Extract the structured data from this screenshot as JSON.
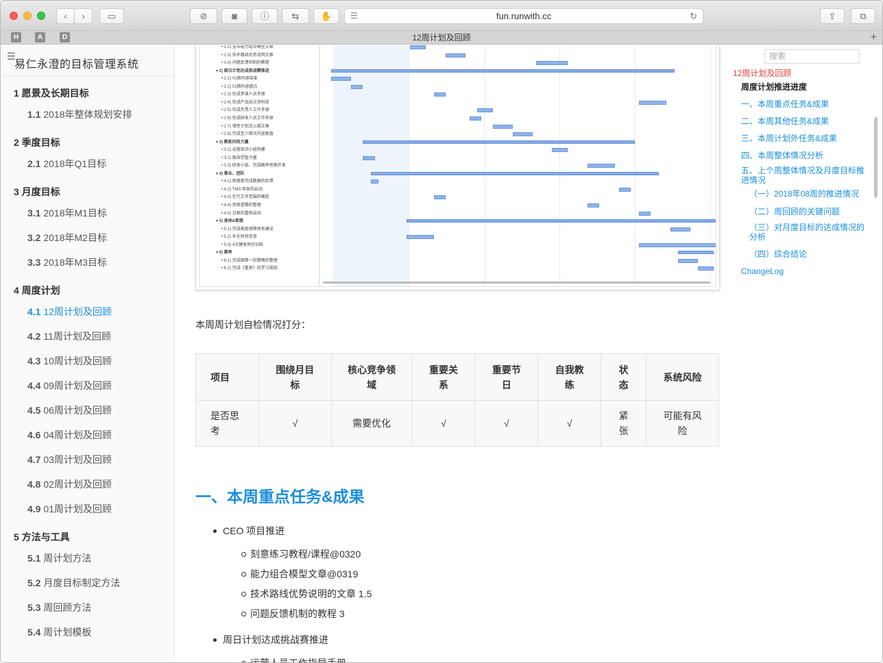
{
  "browser": {
    "url": "fun.runwith.cc",
    "tab_title": "12周计划及回顾",
    "favicons": [
      "H",
      "A",
      "D"
    ]
  },
  "sidebar": {
    "site_title": "易仁永澄的目标管理系统",
    "sections": [
      {
        "num": "1",
        "label": "愿景及长期目标",
        "items": [
          {
            "num": "1.1",
            "label": "2018年整体规划安排"
          }
        ]
      },
      {
        "num": "2",
        "label": "季度目标",
        "items": [
          {
            "num": "2.1",
            "label": "2018年Q1目标"
          }
        ]
      },
      {
        "num": "3",
        "label": "月度目标",
        "items": [
          {
            "num": "3.1",
            "label": "2018年M1目标"
          },
          {
            "num": "3.2",
            "label": "2018年M2目标"
          },
          {
            "num": "3.3",
            "label": "2018年M3目标"
          }
        ]
      },
      {
        "num": "4",
        "label": "周度计划",
        "items": [
          {
            "num": "4.1",
            "label": "12周计划及回顾"
          },
          {
            "num": "4.2",
            "label": "11周计划及回顾"
          },
          {
            "num": "4.3",
            "label": "10周计划及回顾"
          },
          {
            "num": "4.4",
            "label": "09周计划及回顾"
          },
          {
            "num": "4.5",
            "label": "06周计划及回顾"
          },
          {
            "num": "4.6",
            "label": "04周计划及回顾"
          },
          {
            "num": "4.7",
            "label": "03周计划及回顾"
          },
          {
            "num": "4.8",
            "label": "02周计划及回顾"
          },
          {
            "num": "4.9",
            "label": "01周计划及回顾"
          }
        ]
      },
      {
        "num": "5",
        "label": "方法与工具",
        "items": [
          {
            "num": "5.1",
            "label": "周计划方法"
          },
          {
            "num": "5.2",
            "label": "月度目标制定方法"
          },
          {
            "num": "5.3",
            "label": "周回顾方法"
          },
          {
            "num": "5.4",
            "label": "周计划模板"
          }
        ]
      }
    ]
  },
  "gantt": {
    "rows": [
      "• 1.2) 宣布能力组合模型文章",
      "• 1.3) 技术路线优势说明文章",
      "• 1.4) 问题反馈机制的教程",
      "▾ 2) 周日计划达成挑战赛推进",
      "• 2.1) 01期内容结束",
      "• 2.2) 01期内容盘点",
      "• 2.3) 形成参谋人员手册",
      "• 2.4) 形成产品站点资料库",
      "• 2.5) 形成负责人工作手册",
      "• 2.6) 形成研发人员工作手册",
      "• 2.7) 律性计划怎么做文章",
      "• 2.8) 完成至少两次内容复盘",
      "▾ 3) 教练问效力量",
      "• 3.1) 运营知识小组构建",
      "• 3.2) 做自您智力量",
      "• 3.3) 研发小组、完成概率思维开发",
      "▾ 4) 事业、团队",
      "• 4.1) 梳理甚完成数据的反馈",
      "• 4.2) TMS 项目的启动",
      "• 4.3) 在行工作范围的确定",
      "• 4.4) 思维逻辑的整理",
      "• 4.5) 日更的重新启动",
      "▾ 5) 身体&家庭",
      "• 5.1) 完成家庭保障体系建设",
      "• 5.2) 补全财务信息",
      "• 5.3) 4次健身房的训练",
      "▾ 6) 素养",
      "• 6.1) 完成微第一的策略的整理",
      "• 6.2) 完成《重来》的学习规划"
    ],
    "bars": [
      [
        0.23,
        0.04
      ],
      [
        0.32,
        0.05
      ],
      [
        0.55,
        0.08
      ],
      [
        0.03,
        0.87
      ],
      [
        0.03,
        0.05
      ],
      [
        0.08,
        0.03
      ],
      [
        0.29,
        0.03
      ],
      [
        0.81,
        0.07
      ],
      [
        0.4,
        0.04
      ],
      [
        0.38,
        0.03
      ],
      [
        0.44,
        0.05
      ],
      [
        0.49,
        0.05
      ],
      [
        0.11,
        0.69
      ],
      [
        0.59,
        0.04
      ],
      [
        0.11,
        0.03
      ],
      [
        0.68,
        0.07
      ],
      [
        0.13,
        0.73
      ],
      [
        0.13,
        0.02
      ],
      [
        0.76,
        0.03
      ],
      [
        0.29,
        0.03
      ],
      [
        0.68,
        0.03
      ],
      [
        0.81,
        0.03
      ],
      [
        0.22,
        0.8
      ],
      [
        0.89,
        0.05
      ],
      [
        0.22,
        0.07
      ],
      [
        0.81,
        0.2
      ],
      [
        0.91,
        0.09
      ],
      [
        0.91,
        0.05
      ],
      [
        0.96,
        0.04
      ]
    ],
    "collapse_rows": [
      3,
      12,
      16,
      22,
      26
    ]
  },
  "main": {
    "intro": "本周周计划自检情况打分：",
    "table": {
      "headers": [
        "项目",
        "围绕月目\n标",
        "核心竞争领\n域",
        "重要关\n系",
        "重要节\n日",
        "自我教\n练",
        "状\n态",
        "系统风险"
      ],
      "row": [
        "是否思\n考",
        "√",
        "需要优化",
        "√",
        "√",
        "√",
        "紧\n张",
        "可能有风\n险"
      ]
    },
    "section_title": "一、本周重点任务&成果",
    "tasks": [
      {
        "label": "CEO 项目推进",
        "subs": [
          "刻意练习教程/课程@0320",
          "能力组合模型文章@0319",
          "技术路线优势说明的文章 1.5",
          "问题反馈机制的教程 3"
        ]
      },
      {
        "label": "周日计划达成挑战赛推进",
        "subs": [
          "运营人员工作指导手册"
        ]
      }
    ]
  },
  "toc": {
    "search_placeholder": "搜索",
    "items": [
      {
        "label": "12周计划及回顾",
        "kind": "cur"
      },
      {
        "label": "周度计划推进进度",
        "kind": "head"
      },
      {
        "label": "一、本周重点任务&成果",
        "kind": "l1"
      },
      {
        "label": "二、本周其他任务&成果",
        "kind": "l1"
      },
      {
        "label": "三、本周计划外任务&成果",
        "kind": "l1"
      },
      {
        "label": "四、本周整体情况分析",
        "kind": "l1"
      },
      {
        "label": "五、上个周整体情况及月度目标推进情况",
        "kind": "l1"
      },
      {
        "label": "（一）2018年08周的推进情况",
        "kind": "l2"
      },
      {
        "label": "（二）周回顾的关键问题",
        "kind": "l2"
      },
      {
        "label": "（三）对月度目标的达成情况的分析",
        "kind": "l2"
      },
      {
        "label": "（四）综合结论",
        "kind": "l2"
      },
      {
        "label": "ChangeLog",
        "kind": "l1"
      }
    ]
  },
  "colors": {
    "accent": "#1a8fdd",
    "toc_current": "#e5403c",
    "gantt_bar": "#8fb4ea"
  }
}
